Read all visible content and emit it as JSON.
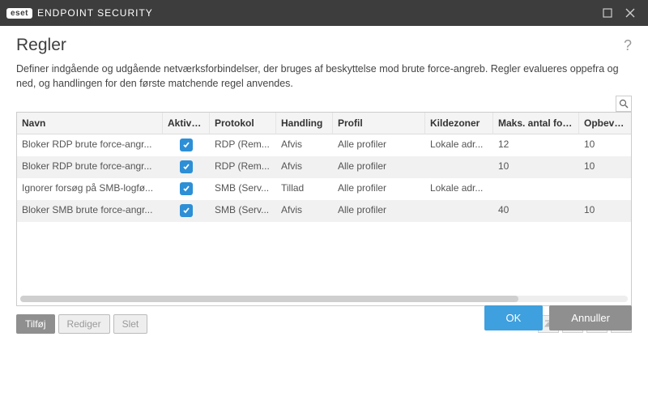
{
  "titlebar": {
    "brand": "eset",
    "product": "ENDPOINT SECURITY"
  },
  "page": {
    "title": "Regler",
    "description": "Definer indgående og udgående netværksforbindelser, der bruges af beskyttelse mod brute force-angreb. Regler evalueres oppefra og ned, og handlingen for den første matchende regel anvendes."
  },
  "columns": {
    "name": "Navn",
    "enabled": "Aktiveret",
    "protocol": "Protokol",
    "action": "Handling",
    "profile": "Profil",
    "sourceZones": "Kildezoner",
    "maxAttempts": "Maks. antal forsøg",
    "retention": "Opbevaringsp"
  },
  "rows": [
    {
      "name": "Bloker RDP brute force-angr...",
      "enabled": true,
      "protocol": "RDP (Rem...",
      "action": "Afvis",
      "profile": "Alle profiler",
      "sourceZones": "Lokale adr...",
      "maxAttempts": "12",
      "retention": "10"
    },
    {
      "name": "Bloker RDP brute force-angr...",
      "enabled": true,
      "protocol": "RDP (Rem...",
      "action": "Afvis",
      "profile": "Alle profiler",
      "sourceZones": "",
      "maxAttempts": "10",
      "retention": "10"
    },
    {
      "name": "Ignorer forsøg på SMB-logfø...",
      "enabled": true,
      "protocol": "SMB (Serv...",
      "action": "Tillad",
      "profile": "Alle profiler",
      "sourceZones": "Lokale adr...",
      "maxAttempts": "",
      "retention": ""
    },
    {
      "name": "Bloker SMB brute force-angr...",
      "enabled": true,
      "protocol": "SMB (Serv...",
      "action": "Afvis",
      "profile": "Alle profiler",
      "sourceZones": "",
      "maxAttempts": "40",
      "retention": "10"
    }
  ],
  "toolbar": {
    "add": "Tilføj",
    "edit": "Rediger",
    "delete": "Slet"
  },
  "footer": {
    "ok": "OK",
    "cancel": "Annuller"
  }
}
